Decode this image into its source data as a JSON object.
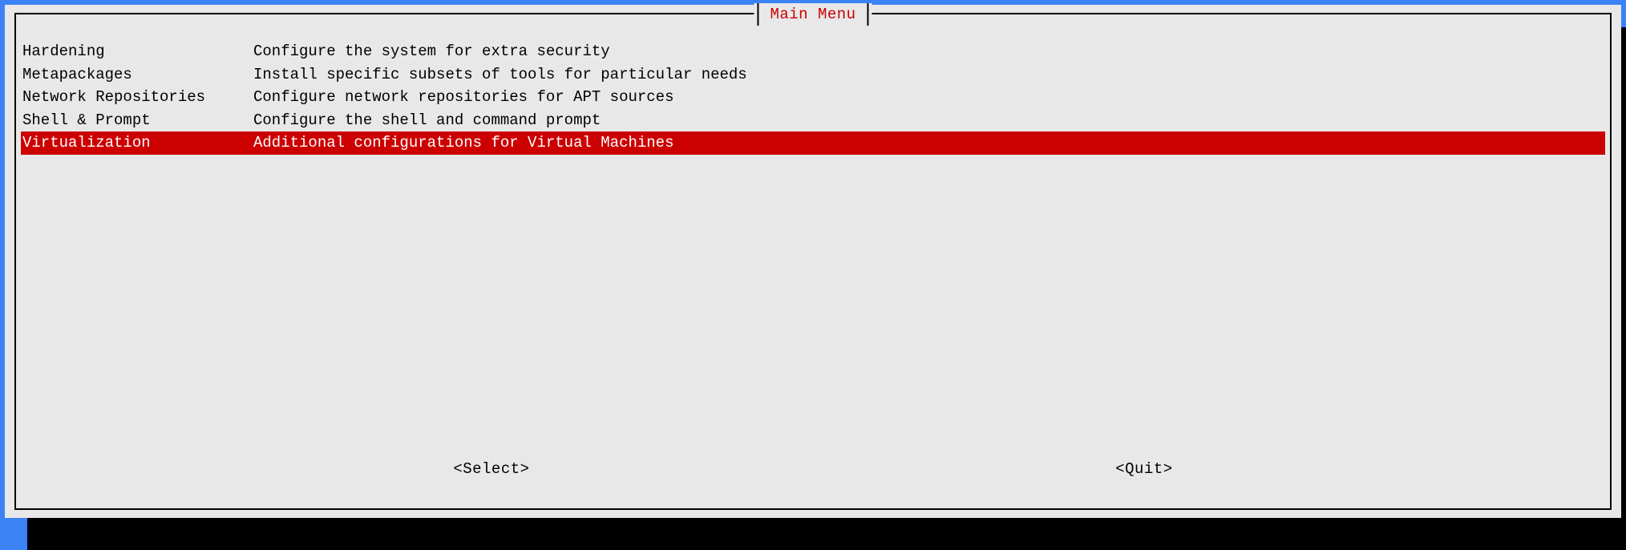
{
  "title": "Main Menu",
  "menu": {
    "items": [
      {
        "label": "Hardening",
        "desc": "Configure the system for extra security",
        "selected": false
      },
      {
        "label": "Metapackages",
        "desc": "Install specific subsets of tools for particular needs",
        "selected": false
      },
      {
        "label": "Network Repositories",
        "desc": "Configure network repositories for APT sources",
        "selected": false
      },
      {
        "label": "Shell & Prompt",
        "desc": "Configure the shell and command prompt",
        "selected": false
      },
      {
        "label": "Virtualization",
        "desc": "Additional configurations for Virtual Machines",
        "selected": true
      }
    ]
  },
  "buttons": {
    "select": "<Select>",
    "quit": "<Quit>"
  }
}
